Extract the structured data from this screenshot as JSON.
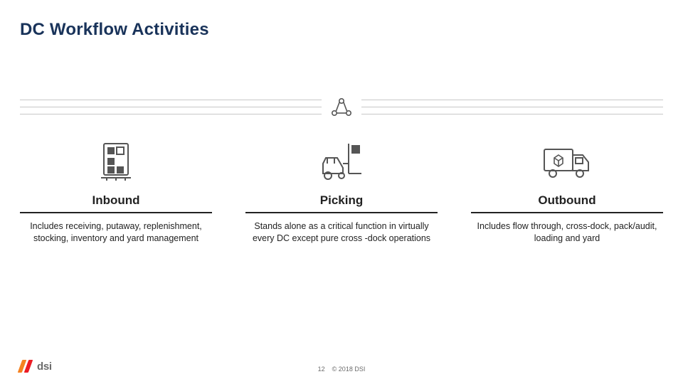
{
  "title": "DC Workflow Activities",
  "center_icon": "compliance-cycle-icon",
  "columns": [
    {
      "icon": "inbound-pallet-icon",
      "heading": "Inbound",
      "body": "Includes receiving, putaway, replenishment, stocking, inventory and yard management"
    },
    {
      "icon": "forklift-icon",
      "heading": "Picking",
      "body": "Stands alone as a critical function in virtually every DC except pure cross -dock operations"
    },
    {
      "icon": "truck-icon",
      "heading": "Outbound",
      "body": "Includes flow through, cross-dock, pack/audit, loading and yard"
    }
  ],
  "footer": {
    "page_number": "12",
    "copyright": "© 2018 DSI",
    "logo_text": "dsi"
  },
  "colors": {
    "title": "#19335a",
    "icon": "#555555",
    "logo_orange": "#f58220",
    "logo_red": "#ec1c24"
  }
}
